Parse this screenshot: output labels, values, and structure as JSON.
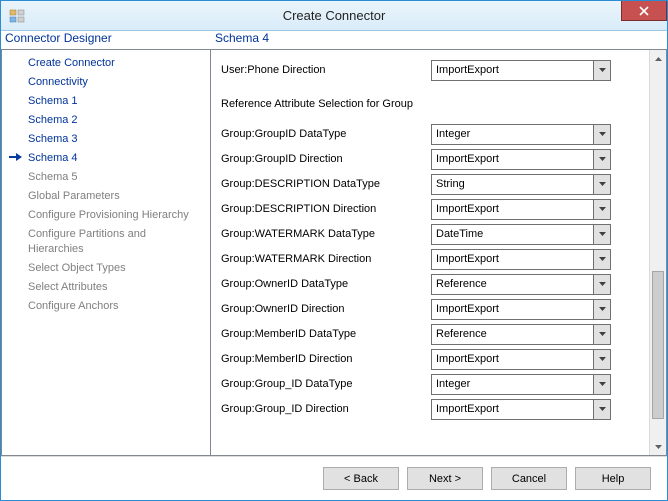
{
  "window": {
    "title": "Create Connector"
  },
  "sidebar": {
    "heading": "Connector Designer",
    "items": [
      {
        "label": "Create Connector",
        "dim": false,
        "current": false
      },
      {
        "label": "Connectivity",
        "dim": false,
        "current": false
      },
      {
        "label": "Schema 1",
        "dim": false,
        "current": false
      },
      {
        "label": "Schema 2",
        "dim": false,
        "current": false
      },
      {
        "label": "Schema 3",
        "dim": false,
        "current": false
      },
      {
        "label": "Schema 4",
        "dim": false,
        "current": true
      },
      {
        "label": "Schema 5",
        "dim": true,
        "current": false
      },
      {
        "label": "Global Parameters",
        "dim": true,
        "current": false
      },
      {
        "label": "Configure Provisioning Hierarchy",
        "dim": true,
        "current": false
      },
      {
        "label": "Configure Partitions and Hierarchies",
        "dim": true,
        "current": false
      },
      {
        "label": "Select Object Types",
        "dim": true,
        "current": false
      },
      {
        "label": "Select Attributes",
        "dim": true,
        "current": false
      },
      {
        "label": "Configure Anchors",
        "dim": true,
        "current": false
      }
    ]
  },
  "main": {
    "heading": "Schema 4",
    "top_rows": [
      {
        "label": "User:Phone Direction",
        "value": "ImportExport"
      }
    ],
    "section_heading": "Reference Attribute Selection for Group",
    "rows": [
      {
        "label": "Group:GroupID DataType",
        "value": "Integer"
      },
      {
        "label": "Group:GroupID Direction",
        "value": "ImportExport"
      },
      {
        "label": "Group:DESCRIPTION DataType",
        "value": "String"
      },
      {
        "label": "Group:DESCRIPTION Direction",
        "value": "ImportExport"
      },
      {
        "label": "Group:WATERMARK DataType",
        "value": "DateTime"
      },
      {
        "label": "Group:WATERMARK Direction",
        "value": "ImportExport"
      },
      {
        "label": "Group:OwnerID DataType",
        "value": "Reference"
      },
      {
        "label": "Group:OwnerID Direction",
        "value": "ImportExport"
      },
      {
        "label": "Group:MemberID DataType",
        "value": "Reference"
      },
      {
        "label": "Group:MemberID Direction",
        "value": "ImportExport"
      },
      {
        "label": "Group:Group_ID DataType",
        "value": "Integer"
      },
      {
        "label": "Group:Group_ID Direction",
        "value": "ImportExport"
      }
    ]
  },
  "buttons": {
    "back": "<  Back",
    "next": "Next  >",
    "cancel": "Cancel",
    "help": "Help"
  }
}
